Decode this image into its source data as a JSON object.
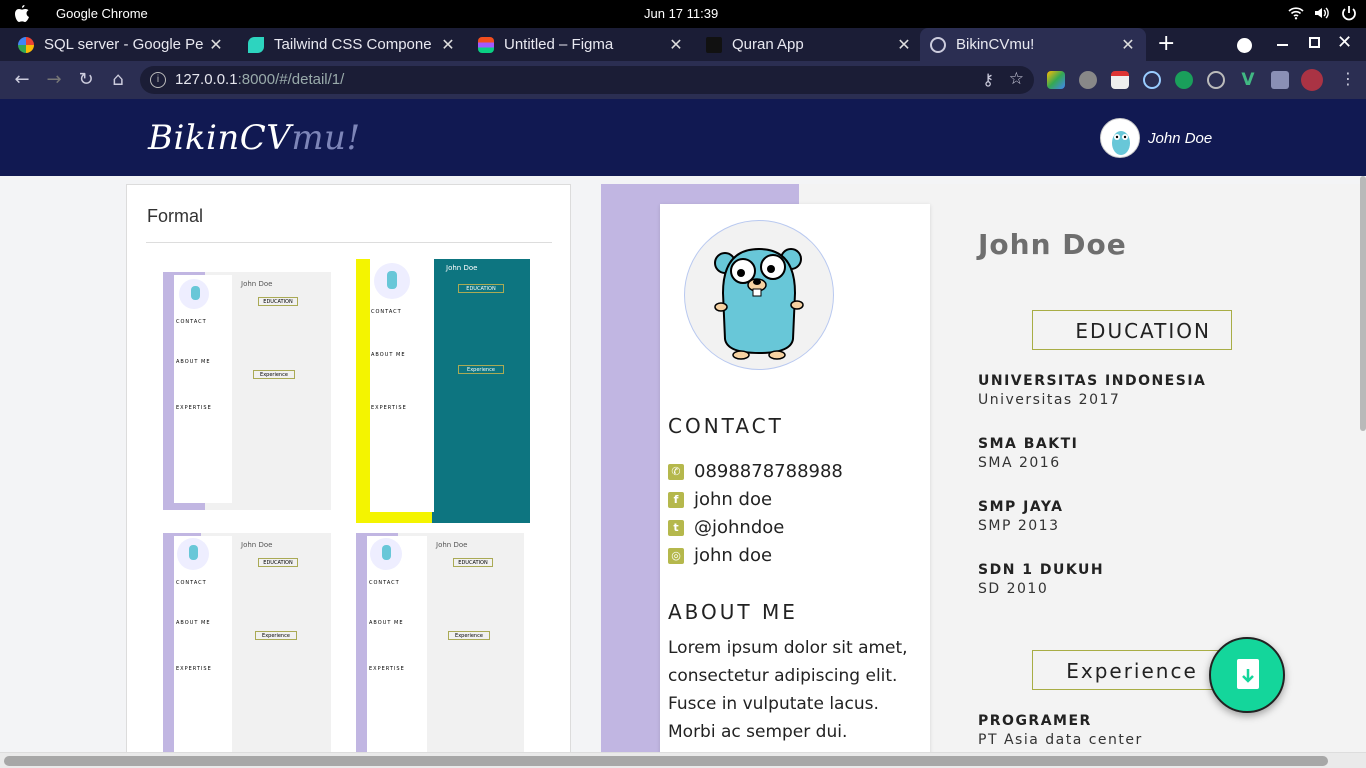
{
  "os": {
    "app_name": "Google Chrome",
    "clock": "Jun 17  11:39"
  },
  "browser": {
    "tabs": [
      {
        "title": "SQL server - Google Pe",
        "favicon": "google-icon"
      },
      {
        "title": "Tailwind CSS Compone",
        "favicon": "tailwind-icon"
      },
      {
        "title": "Untitled – Figma",
        "favicon": "figma-icon"
      },
      {
        "title": "Quran App",
        "favicon": "quran-icon"
      },
      {
        "title": "BikinCVmu!",
        "favicon": "globe-icon",
        "active": true
      }
    ],
    "url_host": "127.0.0.1",
    "url_rest": ":8000/#/detail/1/"
  },
  "header": {
    "logo_main": "BikinCV",
    "logo_suffix": "mu!",
    "user_name": "John Doe"
  },
  "templates": {
    "title": "Formal",
    "mini_name": "John Doe",
    "mini_education": "EDUCATION",
    "mini_experience": "Experience",
    "mini_contact": "CONTACT",
    "mini_about": "ABOUT ME",
    "mini_expertise": "EXPERTISE"
  },
  "cv": {
    "name": "John Doe",
    "contact_title": "CONTACT",
    "contacts": [
      {
        "icon": "phone-icon",
        "value": "0898878788988"
      },
      {
        "icon": "facebook-icon",
        "value": "john doe"
      },
      {
        "icon": "twitter-icon",
        "value": "@johndoe"
      },
      {
        "icon": "instagram-icon",
        "value": "john doe"
      }
    ],
    "about_title": "ABOUT ME",
    "about_text": "Lorem ipsum dolor sit amet, consectetur adipiscing elit. Fusce in vulputate lacus. Morbi ac semper dui. Interdum et",
    "education_title": "EDUCATION",
    "education": [
      {
        "school": "UNIVERSITAS INDONESIA",
        "detail": "Universitas 2017"
      },
      {
        "school": "SMA BAKTI",
        "detail": "SMA 2016"
      },
      {
        "school": "SMP JAYA",
        "detail": "SMP 2013"
      },
      {
        "school": "SDN 1 DUKUH",
        "detail": "SD 2010"
      }
    ],
    "experience_title": "Experience",
    "experience": [
      {
        "role": "PROGRAMER",
        "company": "PT Asia data center"
      }
    ]
  },
  "colors": {
    "header": "#111952",
    "accent_lavender": "#c1b6e2",
    "accent_olive": "#a8ad45",
    "fab": "#14d69b"
  }
}
